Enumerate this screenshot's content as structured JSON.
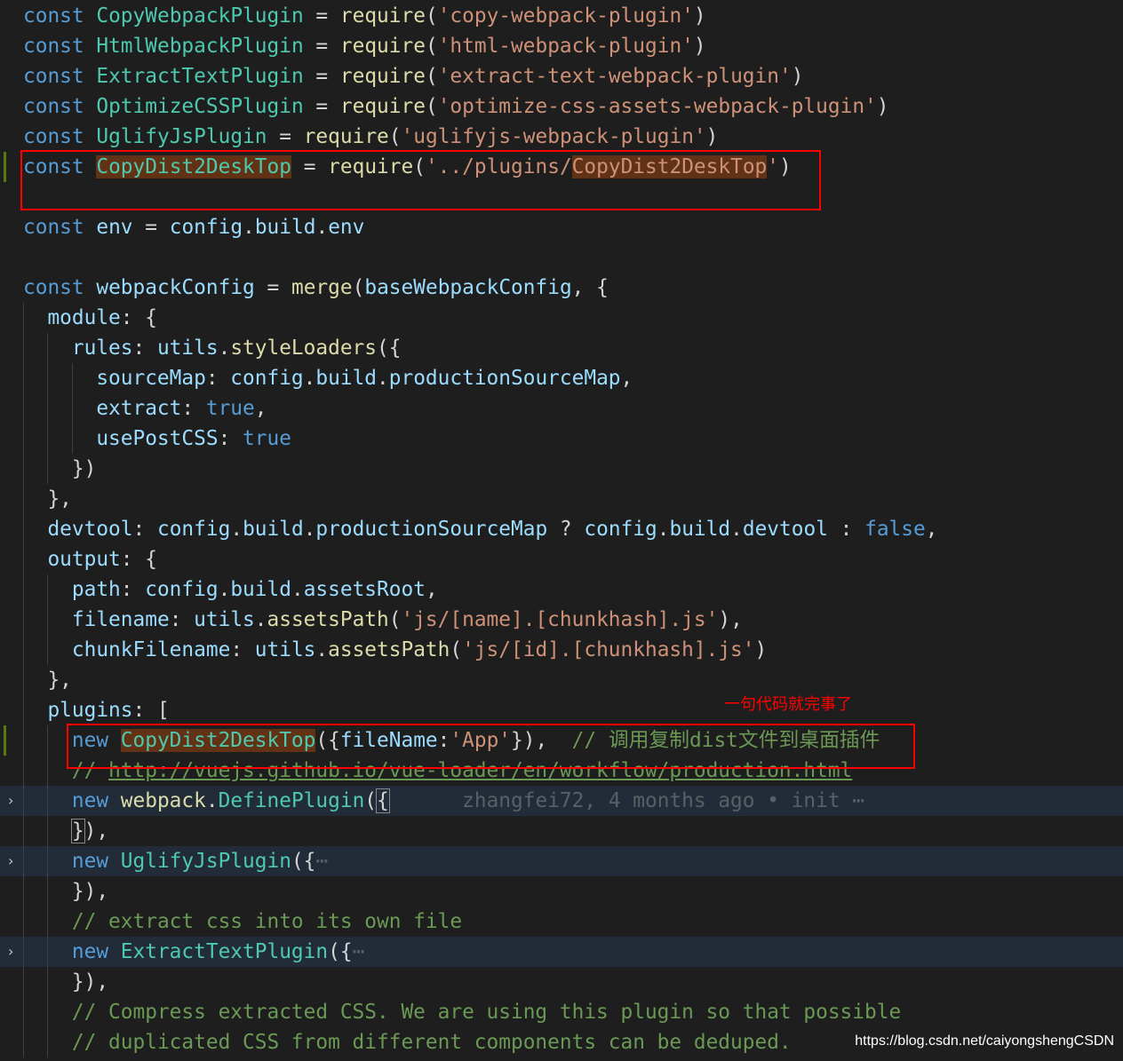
{
  "editor": {
    "theme_colors": {
      "background": "#1e1e1e",
      "keyword": "#569cd6",
      "class": "#4ec9b0",
      "function": "#dcdcaa",
      "variable": "#9cdcfe",
      "string": "#ce9178",
      "comment": "#6a9955",
      "highlight_line": "#222c38",
      "match_highlight": "#613214"
    },
    "lines": [
      {
        "indent": 0,
        "tokens": [
          [
            "kw",
            "const "
          ],
          [
            "cls",
            "CopyWebpackPlugin"
          ],
          [
            "pun",
            " = "
          ],
          [
            "fn",
            "require"
          ],
          [
            "pun",
            "("
          ],
          [
            "str",
            "'copy-webpack-plugin'"
          ],
          [
            "pun",
            ")"
          ]
        ]
      },
      {
        "indent": 0,
        "tokens": [
          [
            "kw",
            "const "
          ],
          [
            "cls",
            "HtmlWebpackPlugin"
          ],
          [
            "pun",
            " = "
          ],
          [
            "fn",
            "require"
          ],
          [
            "pun",
            "("
          ],
          [
            "str",
            "'html-webpack-plugin'"
          ],
          [
            "pun",
            ")"
          ]
        ]
      },
      {
        "indent": 0,
        "tokens": [
          [
            "kw",
            "const "
          ],
          [
            "cls",
            "ExtractTextPlugin"
          ],
          [
            "pun",
            " = "
          ],
          [
            "fn",
            "require"
          ],
          [
            "pun",
            "("
          ],
          [
            "str",
            "'extract-text-webpack-plugin'"
          ],
          [
            "pun",
            ")"
          ]
        ]
      },
      {
        "indent": 0,
        "tokens": [
          [
            "kw",
            "const "
          ],
          [
            "cls",
            "OptimizeCSSPlugin"
          ],
          [
            "pun",
            " = "
          ],
          [
            "fn",
            "require"
          ],
          [
            "pun",
            "("
          ],
          [
            "str",
            "'optimize-css-assets-webpack-plugin'"
          ],
          [
            "pun",
            ")"
          ]
        ]
      },
      {
        "indent": 0,
        "tokens": [
          [
            "kw",
            "const "
          ],
          [
            "cls",
            "UglifyJsPlugin"
          ],
          [
            "pun",
            " = "
          ],
          [
            "fn",
            "require"
          ],
          [
            "pun",
            "("
          ],
          [
            "str",
            "'uglifyjs-webpack-plugin'"
          ],
          [
            "pun",
            ")"
          ]
        ]
      },
      {
        "indent": 0,
        "git": true,
        "tokens": [
          [
            "kw",
            "const "
          ],
          [
            "cls match",
            "CopyDist2DeskTop"
          ],
          [
            "pun",
            " = "
          ],
          [
            "fn",
            "require"
          ],
          [
            "pun",
            "("
          ],
          [
            "str",
            "'../plugins/"
          ],
          [
            "str match",
            "CopyDist2DeskTop"
          ],
          [
            "str",
            "'"
          ],
          [
            "pun",
            ")"
          ]
        ]
      },
      {
        "indent": 0,
        "tokens": []
      },
      {
        "indent": 0,
        "tokens": [
          [
            "kw",
            "const "
          ],
          [
            "var",
            "env"
          ],
          [
            "pun",
            " = "
          ],
          [
            "var",
            "config"
          ],
          [
            "pun",
            "."
          ],
          [
            "var",
            "build"
          ],
          [
            "pun",
            "."
          ],
          [
            "var",
            "env"
          ]
        ]
      },
      {
        "indent": 0,
        "tokens": []
      },
      {
        "indent": 0,
        "tokens": [
          [
            "kw",
            "const "
          ],
          [
            "var",
            "webpackConfig"
          ],
          [
            "pun",
            " = "
          ],
          [
            "fn",
            "merge"
          ],
          [
            "pun",
            "("
          ],
          [
            "var",
            "baseWebpackConfig"
          ],
          [
            "pun",
            ", {"
          ]
        ]
      },
      {
        "indent": 1,
        "tokens": [
          [
            "var",
            "module"
          ],
          [
            "pun",
            ": {"
          ]
        ]
      },
      {
        "indent": 2,
        "tokens": [
          [
            "var",
            "rules"
          ],
          [
            "pun",
            ": "
          ],
          [
            "var",
            "utils"
          ],
          [
            "pun",
            "."
          ],
          [
            "fn",
            "styleLoaders"
          ],
          [
            "pun",
            "({"
          ]
        ]
      },
      {
        "indent": 3,
        "tokens": [
          [
            "var",
            "sourceMap"
          ],
          [
            "pun",
            ": "
          ],
          [
            "var",
            "config"
          ],
          [
            "pun",
            "."
          ],
          [
            "var",
            "build"
          ],
          [
            "pun",
            "."
          ],
          [
            "var",
            "productionSourceMap"
          ],
          [
            "pun",
            ","
          ]
        ]
      },
      {
        "indent": 3,
        "tokens": [
          [
            "var",
            "extract"
          ],
          [
            "pun",
            ": "
          ],
          [
            "kw",
            "true"
          ],
          [
            "pun",
            ","
          ]
        ]
      },
      {
        "indent": 3,
        "tokens": [
          [
            "var",
            "usePostCSS"
          ],
          [
            "pun",
            ": "
          ],
          [
            "kw",
            "true"
          ]
        ]
      },
      {
        "indent": 2,
        "tokens": [
          [
            "pun",
            "})"
          ]
        ]
      },
      {
        "indent": 1,
        "tokens": [
          [
            "pun",
            "},"
          ]
        ]
      },
      {
        "indent": 1,
        "tokens": [
          [
            "var",
            "devtool"
          ],
          [
            "pun",
            ": "
          ],
          [
            "var",
            "config"
          ],
          [
            "pun",
            "."
          ],
          [
            "var",
            "build"
          ],
          [
            "pun",
            "."
          ],
          [
            "var",
            "productionSourceMap"
          ],
          [
            "pun",
            " ? "
          ],
          [
            "var",
            "config"
          ],
          [
            "pun",
            "."
          ],
          [
            "var",
            "build"
          ],
          [
            "pun",
            "."
          ],
          [
            "var",
            "devtool"
          ],
          [
            "pun",
            " : "
          ],
          [
            "kw",
            "false"
          ],
          [
            "pun",
            ","
          ]
        ]
      },
      {
        "indent": 1,
        "tokens": [
          [
            "var",
            "output"
          ],
          [
            "pun",
            ": {"
          ]
        ]
      },
      {
        "indent": 2,
        "tokens": [
          [
            "var",
            "path"
          ],
          [
            "pun",
            ": "
          ],
          [
            "var",
            "config"
          ],
          [
            "pun",
            "."
          ],
          [
            "var",
            "build"
          ],
          [
            "pun",
            "."
          ],
          [
            "var",
            "assetsRoot"
          ],
          [
            "pun",
            ","
          ]
        ]
      },
      {
        "indent": 2,
        "tokens": [
          [
            "var",
            "filename"
          ],
          [
            "pun",
            ": "
          ],
          [
            "var",
            "utils"
          ],
          [
            "pun",
            "."
          ],
          [
            "fn",
            "assetsPath"
          ],
          [
            "pun",
            "("
          ],
          [
            "str",
            "'js/[name].[chunkhash].js'"
          ],
          [
            "pun",
            "),"
          ]
        ]
      },
      {
        "indent": 2,
        "tokens": [
          [
            "var",
            "chunkFilename"
          ],
          [
            "pun",
            ": "
          ],
          [
            "var",
            "utils"
          ],
          [
            "pun",
            "."
          ],
          [
            "fn",
            "assetsPath"
          ],
          [
            "pun",
            "("
          ],
          [
            "str",
            "'js/[id].[chunkhash].js'"
          ],
          [
            "pun",
            ")"
          ]
        ]
      },
      {
        "indent": 1,
        "tokens": [
          [
            "pun",
            "},"
          ]
        ]
      },
      {
        "indent": 1,
        "tokens": [
          [
            "var",
            "plugins"
          ],
          [
            "pun",
            ": ["
          ]
        ]
      },
      {
        "indent": 2,
        "git": true,
        "tokens": [
          [
            "kw",
            "new "
          ],
          [
            "cls match",
            "CopyDist2DeskTop"
          ],
          [
            "pun",
            "({"
          ],
          [
            "var",
            "fileName"
          ],
          [
            "pun",
            ":"
          ],
          [
            "str",
            "'App'"
          ],
          [
            "pun",
            "}),  "
          ],
          [
            "cm",
            "// 调用复制dist文件到桌面插件"
          ]
        ]
      },
      {
        "indent": 2,
        "tokens": [
          [
            "cm",
            "// "
          ],
          [
            "cm url",
            "http://vuejs.github.io/vue-loader/en/workflow/production.html"
          ]
        ]
      },
      {
        "indent": 2,
        "hl": true,
        "fold": true,
        "tokens": [
          [
            "kw",
            "new "
          ],
          [
            "fn",
            "webpack"
          ],
          [
            "pun",
            "."
          ],
          [
            "cls",
            "DefinePlugin"
          ],
          [
            "pun",
            "("
          ],
          [
            "pun brk",
            "{"
          ],
          [
            "blame",
            "      zhangfei72, 4 months ago • init ⋯"
          ]
        ]
      },
      {
        "indent": 2,
        "tokens": [
          [
            "pun brk",
            "}"
          ],
          [
            "pun",
            "),"
          ]
        ]
      },
      {
        "indent": 2,
        "hl": true,
        "fold": true,
        "tokens": [
          [
            "kw",
            "new "
          ],
          [
            "cls",
            "UglifyJsPlugin"
          ],
          [
            "pun",
            "({"
          ],
          [
            "blame",
            "⋯"
          ]
        ]
      },
      {
        "indent": 2,
        "tokens": [
          [
            "pun",
            "}),"
          ]
        ]
      },
      {
        "indent": 2,
        "tokens": [
          [
            "cm",
            "// extract css into its own file"
          ]
        ]
      },
      {
        "indent": 2,
        "hl": true,
        "fold": true,
        "tokens": [
          [
            "kw",
            "new "
          ],
          [
            "cls",
            "ExtractTextPlugin"
          ],
          [
            "pun",
            "({"
          ],
          [
            "blame",
            "⋯"
          ]
        ]
      },
      {
        "indent": 2,
        "tokens": [
          [
            "pun",
            "}),"
          ]
        ]
      },
      {
        "indent": 2,
        "tokens": [
          [
            "cm",
            "// Compress extracted CSS. We are using this plugin so that possible"
          ]
        ]
      },
      {
        "indent": 2,
        "tokens": [
          [
            "cm",
            "// duplicated CSS from different components can be deduped."
          ]
        ]
      }
    ]
  },
  "annotation": {
    "note": "一句代码就完事了",
    "color": "#ff0000"
  },
  "watermark": "https://blog.csdn.net/caiyongshengCSDN"
}
